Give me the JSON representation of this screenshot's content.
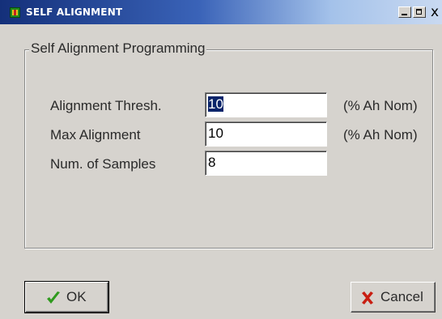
{
  "window": {
    "title": "SELF ALIGNMENT",
    "close_glyph": "x",
    "app_icon": "app-icon"
  },
  "group": {
    "title": "Self Alignment Programming"
  },
  "fields": [
    {
      "label": "Alignment Thresh.",
      "value": "10",
      "selected": true,
      "unit": "(% Ah Nom)"
    },
    {
      "label": "Max Alignment",
      "value": "10",
      "selected": false,
      "unit": "(% Ah Nom)"
    },
    {
      "label": "Num. of Samples",
      "value": "8",
      "selected": false,
      "unit": ""
    }
  ],
  "buttons": {
    "ok": {
      "label": "OK",
      "icon": "check-icon",
      "color": "#2f9a1e"
    },
    "cancel": {
      "label": "Cancel",
      "icon": "x-icon",
      "color": "#c81e12"
    }
  }
}
